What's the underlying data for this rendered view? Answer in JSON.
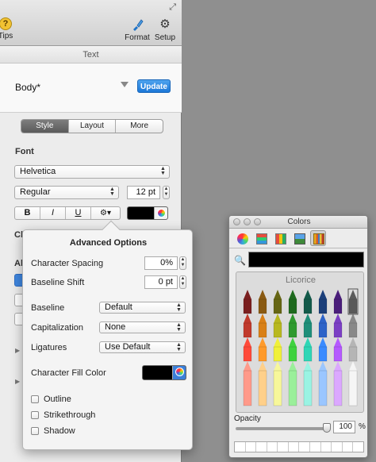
{
  "toolbar": {
    "tips_label": "Tips",
    "format_label": "Format",
    "setup_label": "Setup"
  },
  "inspector": {
    "section_title": "Text",
    "paragraph_style": "Body*",
    "update_label": "Update",
    "tabs": [
      {
        "label": "Style",
        "active": true
      },
      {
        "label": "Layout",
        "active": false
      },
      {
        "label": "More",
        "active": false
      }
    ],
    "font_heading": "Font",
    "font_family": "Helvetica",
    "font_weight": "Regular",
    "font_size": "12 pt",
    "bold_label": "B",
    "italic_label": "I",
    "underline_label": "U",
    "gear_label": "⚙▾",
    "text_color": "#000000",
    "cut_label_1": "Ch",
    "cut_label_2": "Al"
  },
  "advanced_options": {
    "title": "Advanced Options",
    "character_spacing_label": "Character Spacing",
    "character_spacing_value": "0%",
    "baseline_shift_label": "Baseline Shift",
    "baseline_shift_value": "0 pt",
    "baseline_label": "Baseline",
    "baseline_value": "Default",
    "capitalization_label": "Capitalization",
    "capitalization_value": "None",
    "ligatures_label": "Ligatures",
    "ligatures_value": "Use Default",
    "fill_color_label": "Character Fill Color",
    "fill_color": "#000000",
    "checkboxes": [
      {
        "label": "Outline",
        "checked": false
      },
      {
        "label": "Strikethrough",
        "checked": false
      },
      {
        "label": "Shadow",
        "checked": false
      }
    ]
  },
  "colors_panel": {
    "title": "Colors",
    "tabs": [
      "color-wheel-icon",
      "color-sliders-icon",
      "color-palettes-icon",
      "image-palettes-icon",
      "crayons-icon"
    ],
    "active_tab": 4,
    "current_color": "#000000",
    "crayon_name": "Licorice",
    "opacity_label": "Opacity",
    "opacity_value": "100",
    "opacity_unit": "%",
    "opacity_fraction": 1.0
  }
}
